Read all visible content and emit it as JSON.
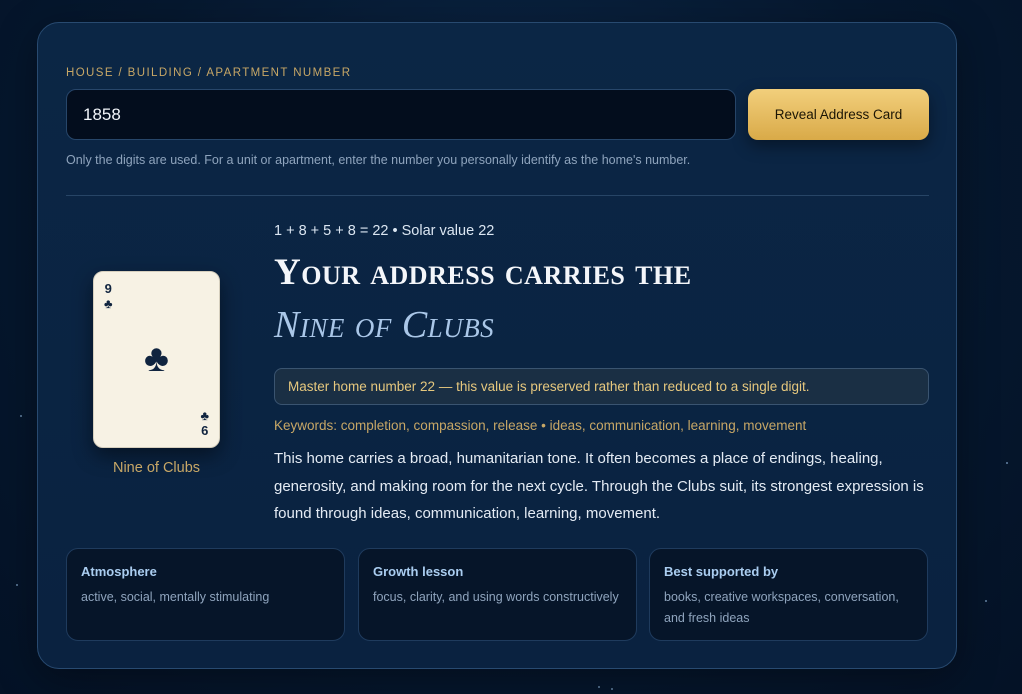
{
  "form": {
    "label": "HOUSE / BUILDING / APARTMENT NUMBER",
    "value": "1858",
    "button_label": "Reveal Address Card",
    "hint": "Only the digits are used. For a unit or apartment, enter the number you personally identify as the home's number."
  },
  "result": {
    "card": {
      "rank_top": "9",
      "suit_symbol": "♣",
      "rank_bottom": "6",
      "caption": "Nine of Clubs"
    },
    "calculation": "1 + 8 + 5 + 8 = 22 • Solar value 22",
    "headline": "Your address carries the",
    "subheadline": "Nine of Clubs",
    "master_note": "Master home number 22 — this value is preserved rather than reduced to a single digit.",
    "keywords": "Keywords: completion, compassion, release • ideas, communication, learning, movement",
    "description": "This home carries a broad, humanitarian tone. It often becomes a place of endings, healing, generosity, and making room for the next cycle. Through the Clubs suit, its strongest expression is found through ideas, communication, learning, movement."
  },
  "info_cards": [
    {
      "title": "Atmosphere",
      "text": "active, social, mentally stimulating"
    },
    {
      "title": "Growth lesson",
      "text": "focus, clarity, and using words constructively"
    },
    {
      "title": "Best supported by",
      "text": "books, creative workspaces, conversation, and fresh ideas"
    }
  ],
  "colors": {
    "accent_gold": "#d9aa48",
    "label_gold": "#c7a766",
    "background": "#06182f",
    "card_face": "#f7f2e4"
  }
}
